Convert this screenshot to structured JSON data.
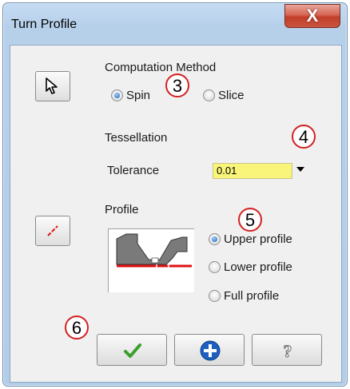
{
  "window": {
    "title": "Turn Profile",
    "close_glyph": "X"
  },
  "computation": {
    "label": "Computation Method",
    "options": [
      {
        "label": "Spin",
        "selected": true
      },
      {
        "label": "Slice",
        "selected": false
      }
    ]
  },
  "tessellation": {
    "label": "Tessellation",
    "tolerance_label": "Tolerance",
    "tolerance_value": "0.01"
  },
  "profile": {
    "label": "Profile",
    "options": [
      {
        "label": "Upper profile",
        "selected": true
      },
      {
        "label": "Lower profile",
        "selected": false
      },
      {
        "label": "Full profile",
        "selected": false
      }
    ]
  },
  "callouts": [
    "3",
    "4",
    "5",
    "6"
  ],
  "buttons": {
    "select_tool_icon": "cursor-arrow-icon",
    "profile_tool_icon": "red-line-icon",
    "ok_icon": "checkmark-icon",
    "add_icon": "plus-icon",
    "help_icon": "question-mark-icon"
  },
  "colors": {
    "tolerance_field": "#f8f57a",
    "callout_ring": "#d42020",
    "profile_line": "#e01010"
  }
}
